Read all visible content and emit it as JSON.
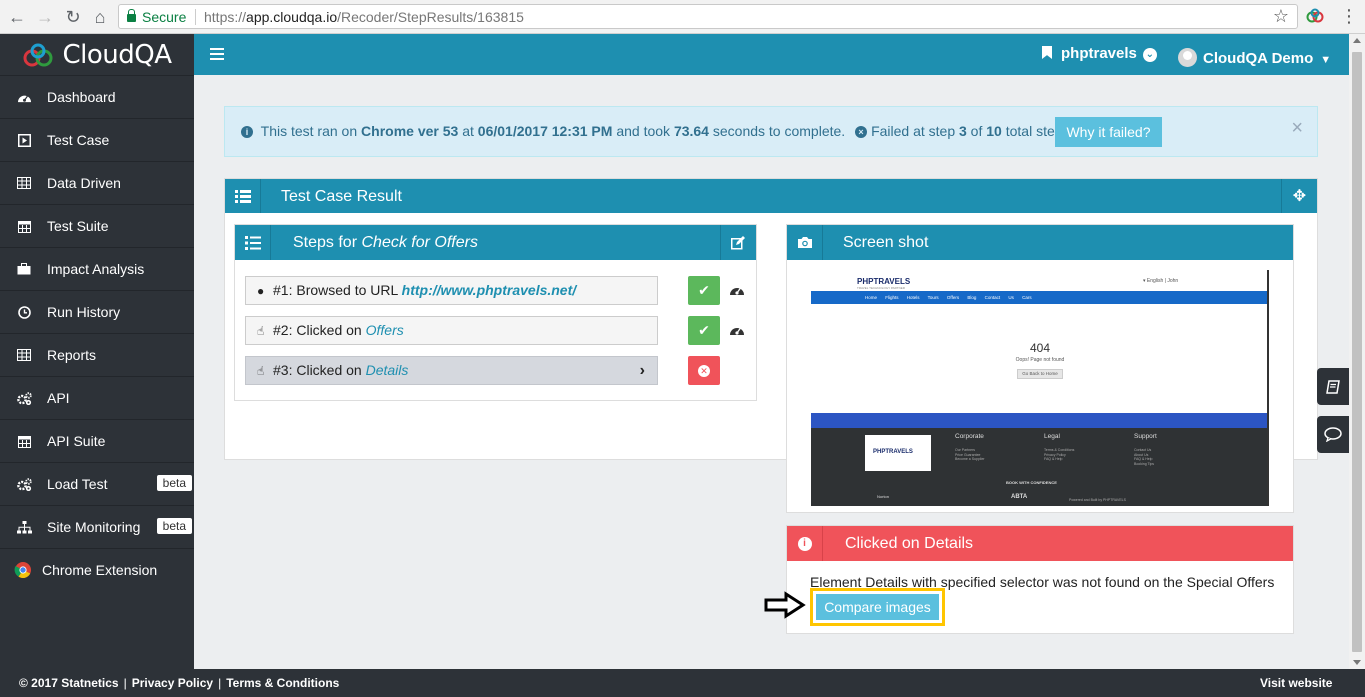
{
  "browser": {
    "secure_label": "Secure",
    "url_scheme": "https://",
    "url_host": "app.cloudqa.io",
    "url_path": "/Recoder/StepResults/163815"
  },
  "sidebar": {
    "logo": "CloudQA",
    "items": [
      {
        "label": "Dashboard",
        "icon": "gauge-icon"
      },
      {
        "label": "Test Case",
        "icon": "play-square-icon"
      },
      {
        "label": "Data Driven",
        "icon": "table-icon"
      },
      {
        "label": "Test Suite",
        "icon": "calendar-icon"
      },
      {
        "label": "Impact Analysis",
        "icon": "briefcase-icon"
      },
      {
        "label": "Run History",
        "icon": "clock-icon"
      },
      {
        "label": "Reports",
        "icon": "table-icon"
      },
      {
        "label": "API",
        "icon": "cogs-icon"
      },
      {
        "label": "API Suite",
        "icon": "calendar-icon"
      },
      {
        "label": "Load Test",
        "icon": "cogs-icon",
        "badge": "beta"
      },
      {
        "label": "Site Monitoring",
        "icon": "sitemap-icon",
        "badge": "beta"
      },
      {
        "label": "Chrome Extension",
        "icon": "chrome-icon"
      }
    ]
  },
  "topbar": {
    "project": "phptravels",
    "user": "CloudQA Demo"
  },
  "alert": {
    "p1": "This test ran on ",
    "browser": "Chrome ver 53",
    "p2": " at ",
    "datetime": "06/01/2017 12:31 PM",
    "p3": " and took ",
    "seconds": "73.64",
    "p4": " seconds to complete.",
    "p5": "Failed at step ",
    "failed_step": "3",
    "p6": " of ",
    "total_steps": "10",
    "p7": " total steps.",
    "why_button": "Why it failed?",
    "close": "×"
  },
  "result_panel": {
    "title": "Test Case Result"
  },
  "steps_panel": {
    "title_prefix": "Steps for ",
    "test_name": "Check for Offers",
    "steps": [
      {
        "prefix": "#1: Browsed to URL ",
        "target": "http://www.phptravels.net/",
        "status": "pass"
      },
      {
        "prefix": "#2: Clicked on ",
        "target": "Offers",
        "status": "pass"
      },
      {
        "prefix": "#3: Clicked on ",
        "target": "Details",
        "status": "fail"
      }
    ]
  },
  "screenshot_panel": {
    "title": "Screen shot",
    "mock": {
      "logo": "PHPTRAVELS",
      "tagline": "TRAVEL TECHNOLOGY PARTNER",
      "lang": "▾  English  |  John",
      "nav": "Home Flights Hotels Tours Offers Blog Contact Us Cars",
      "code": "404",
      "not_found": "Oops! Page not found",
      "home_btn": "Go Back to Home",
      "corporate": "Corporate",
      "corporate_links": [
        "Our Partners",
        "Price Guarantee",
        "Become a Supplier"
      ],
      "legal": "Legal",
      "legal_links": [
        "Terms & Conditions",
        "Privacy Policy",
        "FAQ & Help"
      ],
      "support": "Support",
      "support_links": [
        "Contact Us",
        "About Us",
        "FAQ & Help",
        "Booking Tips"
      ],
      "book": "BOOK WITH CONFIDENCE",
      "norton": "Norton",
      "abta": "ABTA",
      "powered": "Powered and Built by PHPTRAVELS"
    }
  },
  "error_panel": {
    "title": "Clicked on Details",
    "message": "Element Details with specified selector was not found on the Special Offers",
    "compare_button": "Compare images"
  },
  "footer": {
    "copyright": "© 2017 Statnetics",
    "privacy": "Privacy Policy",
    "terms": "Terms & Conditions",
    "visit": "Visit website",
    "sep": "|"
  },
  "colors": {
    "primary": "#1e8fb0",
    "sidebar": "#2d3238",
    "success": "#5cb85c",
    "danger": "#f0535a",
    "info_button": "#5bc0de",
    "highlight": "#ffc500"
  }
}
